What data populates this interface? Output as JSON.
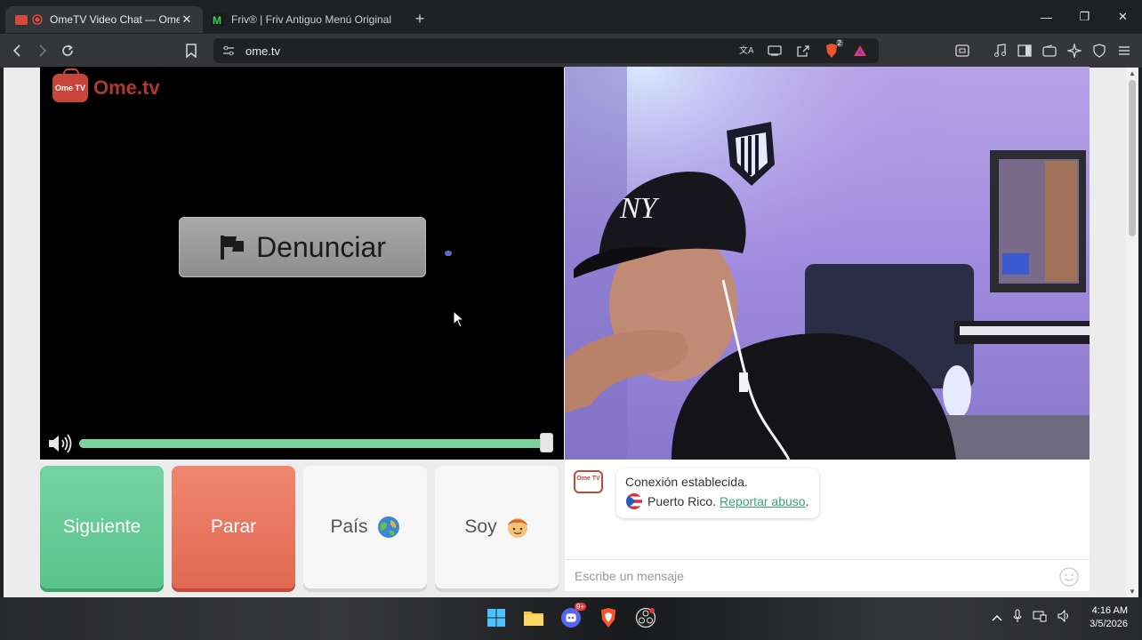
{
  "browser": {
    "tabs": [
      {
        "title": "OmeTV Video Chat — Omegl",
        "active": true
      },
      {
        "title": "Friv® | Friv Antiguo Menú Original",
        "active": false
      }
    ],
    "url": "ome.tv",
    "new_tab": "+",
    "shields_badge": "2"
  },
  "site": {
    "logo_badge": "Ome TV",
    "logo_text": "Ome.tv"
  },
  "video": {
    "report_label": "Denunciar",
    "volume_level": 1.0
  },
  "controls": {
    "next_label": "Siguiente",
    "stop_label": "Parar",
    "country_label": "País",
    "gender_label": "Soy"
  },
  "chat": {
    "logo_badge": "Ome TV",
    "status": "Conexión establecida.",
    "country": "Puerto Rico.",
    "report_link": "Reportar abuso",
    "report_suffix": ".",
    "input_placeholder": "Escribe un mensaje"
  },
  "taskbar": {
    "discord_badge": "9+",
    "time": "4:16 AM",
    "date": "3/5/2026"
  },
  "colors": {
    "next": "#5ac38c",
    "stop": "#e26953",
    "link": "#3aa571",
    "brand": "#c9453b"
  }
}
